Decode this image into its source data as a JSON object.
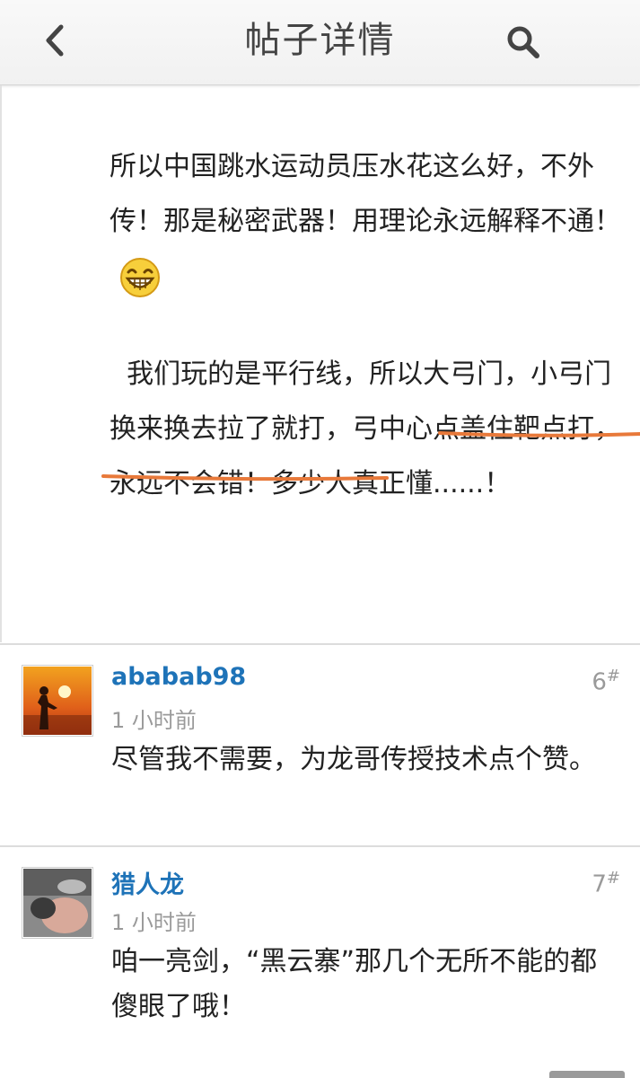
{
  "header": {
    "title": "帖子详情",
    "back_icon": "chevron-left-icon",
    "search_icon": "search-icon"
  },
  "post": {
    "paragraph1": "所以中国跳水运动员压水花这么好，不外传！那是秘密武器！用理论永远解释不通！",
    "emoji": "grinning-face-icon",
    "paragraph2_plain_before": "我们玩的是平行线，所以大弓门，小弓门换来换去拉了就打，",
    "paragraph2_highlight": "弓中心点盖住靶点打，永远不会错",
    "paragraph2_plain_after": "！多少人真正懂......！",
    "highlight_color": "#e8793a"
  },
  "comments": [
    {
      "username": "ababab98",
      "time": "1 小时前",
      "floor_number": "6",
      "floor_suffix": "#",
      "text": "尽管我不需要，为龙哥传授技术点个赞。"
    },
    {
      "username": "猎人龙",
      "time": "1 小时前",
      "floor_number": "7",
      "floor_suffix": "#",
      "text": "咱一亮剑，“黑云寨”那几个无所不能的都傻眼了哦！"
    }
  ],
  "colors": {
    "username": "#1e73b8",
    "muted": "#9a9a9a",
    "text": "#222222"
  }
}
